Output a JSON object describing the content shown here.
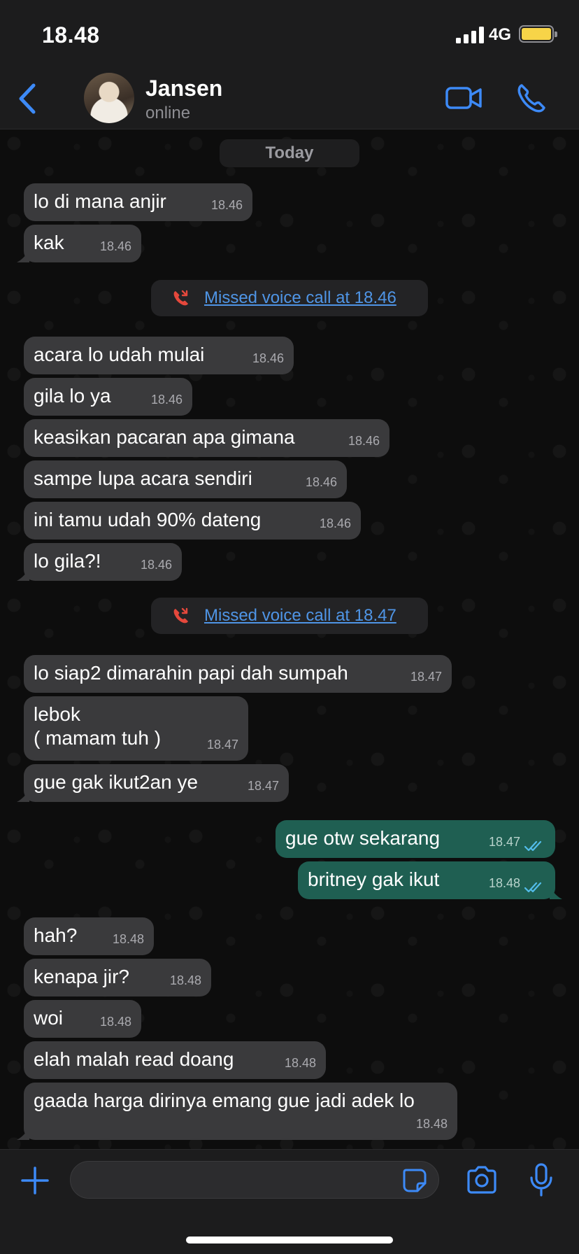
{
  "status_bar": {
    "time": "18.48",
    "network": "4G"
  },
  "header": {
    "contact_name": "Jansen",
    "contact_status": "online"
  },
  "chat": {
    "date_label": "Today",
    "messages_block_1": [
      {
        "text": "lo di mana anjir",
        "time": "18.46"
      },
      {
        "text": "kak",
        "time": "18.46"
      }
    ],
    "missed_call_1": "Missed voice call at 18.46",
    "messages_block_2": [
      {
        "text": "acara lo udah mulai",
        "time": "18.46"
      },
      {
        "text": "gila lo ya",
        "time": "18.46"
      },
      {
        "text": "keasikan pacaran apa gimana",
        "time": "18.46"
      },
      {
        "text": "sampe lupa acara sendiri",
        "time": "18.46"
      },
      {
        "text": "ini tamu udah 90% dateng",
        "time": "18.46"
      },
      {
        "text": "lo gila?!",
        "time": "18.46"
      }
    ],
    "missed_call_2": "Missed voice call at 18.47",
    "messages_block_3": [
      {
        "text": "lo siap2 dimarahin papi dah sumpah",
        "time": "18.47"
      },
      {
        "text": "lebok\n( mamam tuh )",
        "time": "18.47"
      },
      {
        "text": "gue gak ikut2an ye",
        "time": "18.47"
      }
    ],
    "outgoing": [
      {
        "text": "gue otw sekarang",
        "time": "18.47"
      },
      {
        "text": "britney gak ikut",
        "time": "18.48"
      }
    ],
    "messages_block_4": [
      {
        "text": "hah?",
        "time": "18.48"
      },
      {
        "text": "kenapa jir?",
        "time": "18.48"
      },
      {
        "text": "woi",
        "time": "18.48"
      },
      {
        "text": "elah malah read doang",
        "time": "18.48"
      },
      {
        "text": "gaada harga dirinya emang gue jadi adek lo",
        "time": "18.48"
      }
    ]
  },
  "input": {
    "placeholder": ""
  },
  "icons": {
    "back": "chevron-left-icon",
    "video": "video-camera-icon",
    "call": "phone-icon",
    "plus": "plus-icon",
    "sticker": "sticker-icon",
    "camera": "camera-icon",
    "mic": "microphone-icon",
    "missed_call": "missed-call-icon",
    "read": "double-check-icon"
  },
  "colors": {
    "accent": "#3d8af7",
    "incoming_bubble": "#3a3a3c",
    "outgoing_bubble": "#1f5f52",
    "missed_call_icon": "#e5483c",
    "battery": "#f7d448",
    "read_ticks": "#53bdeb"
  }
}
